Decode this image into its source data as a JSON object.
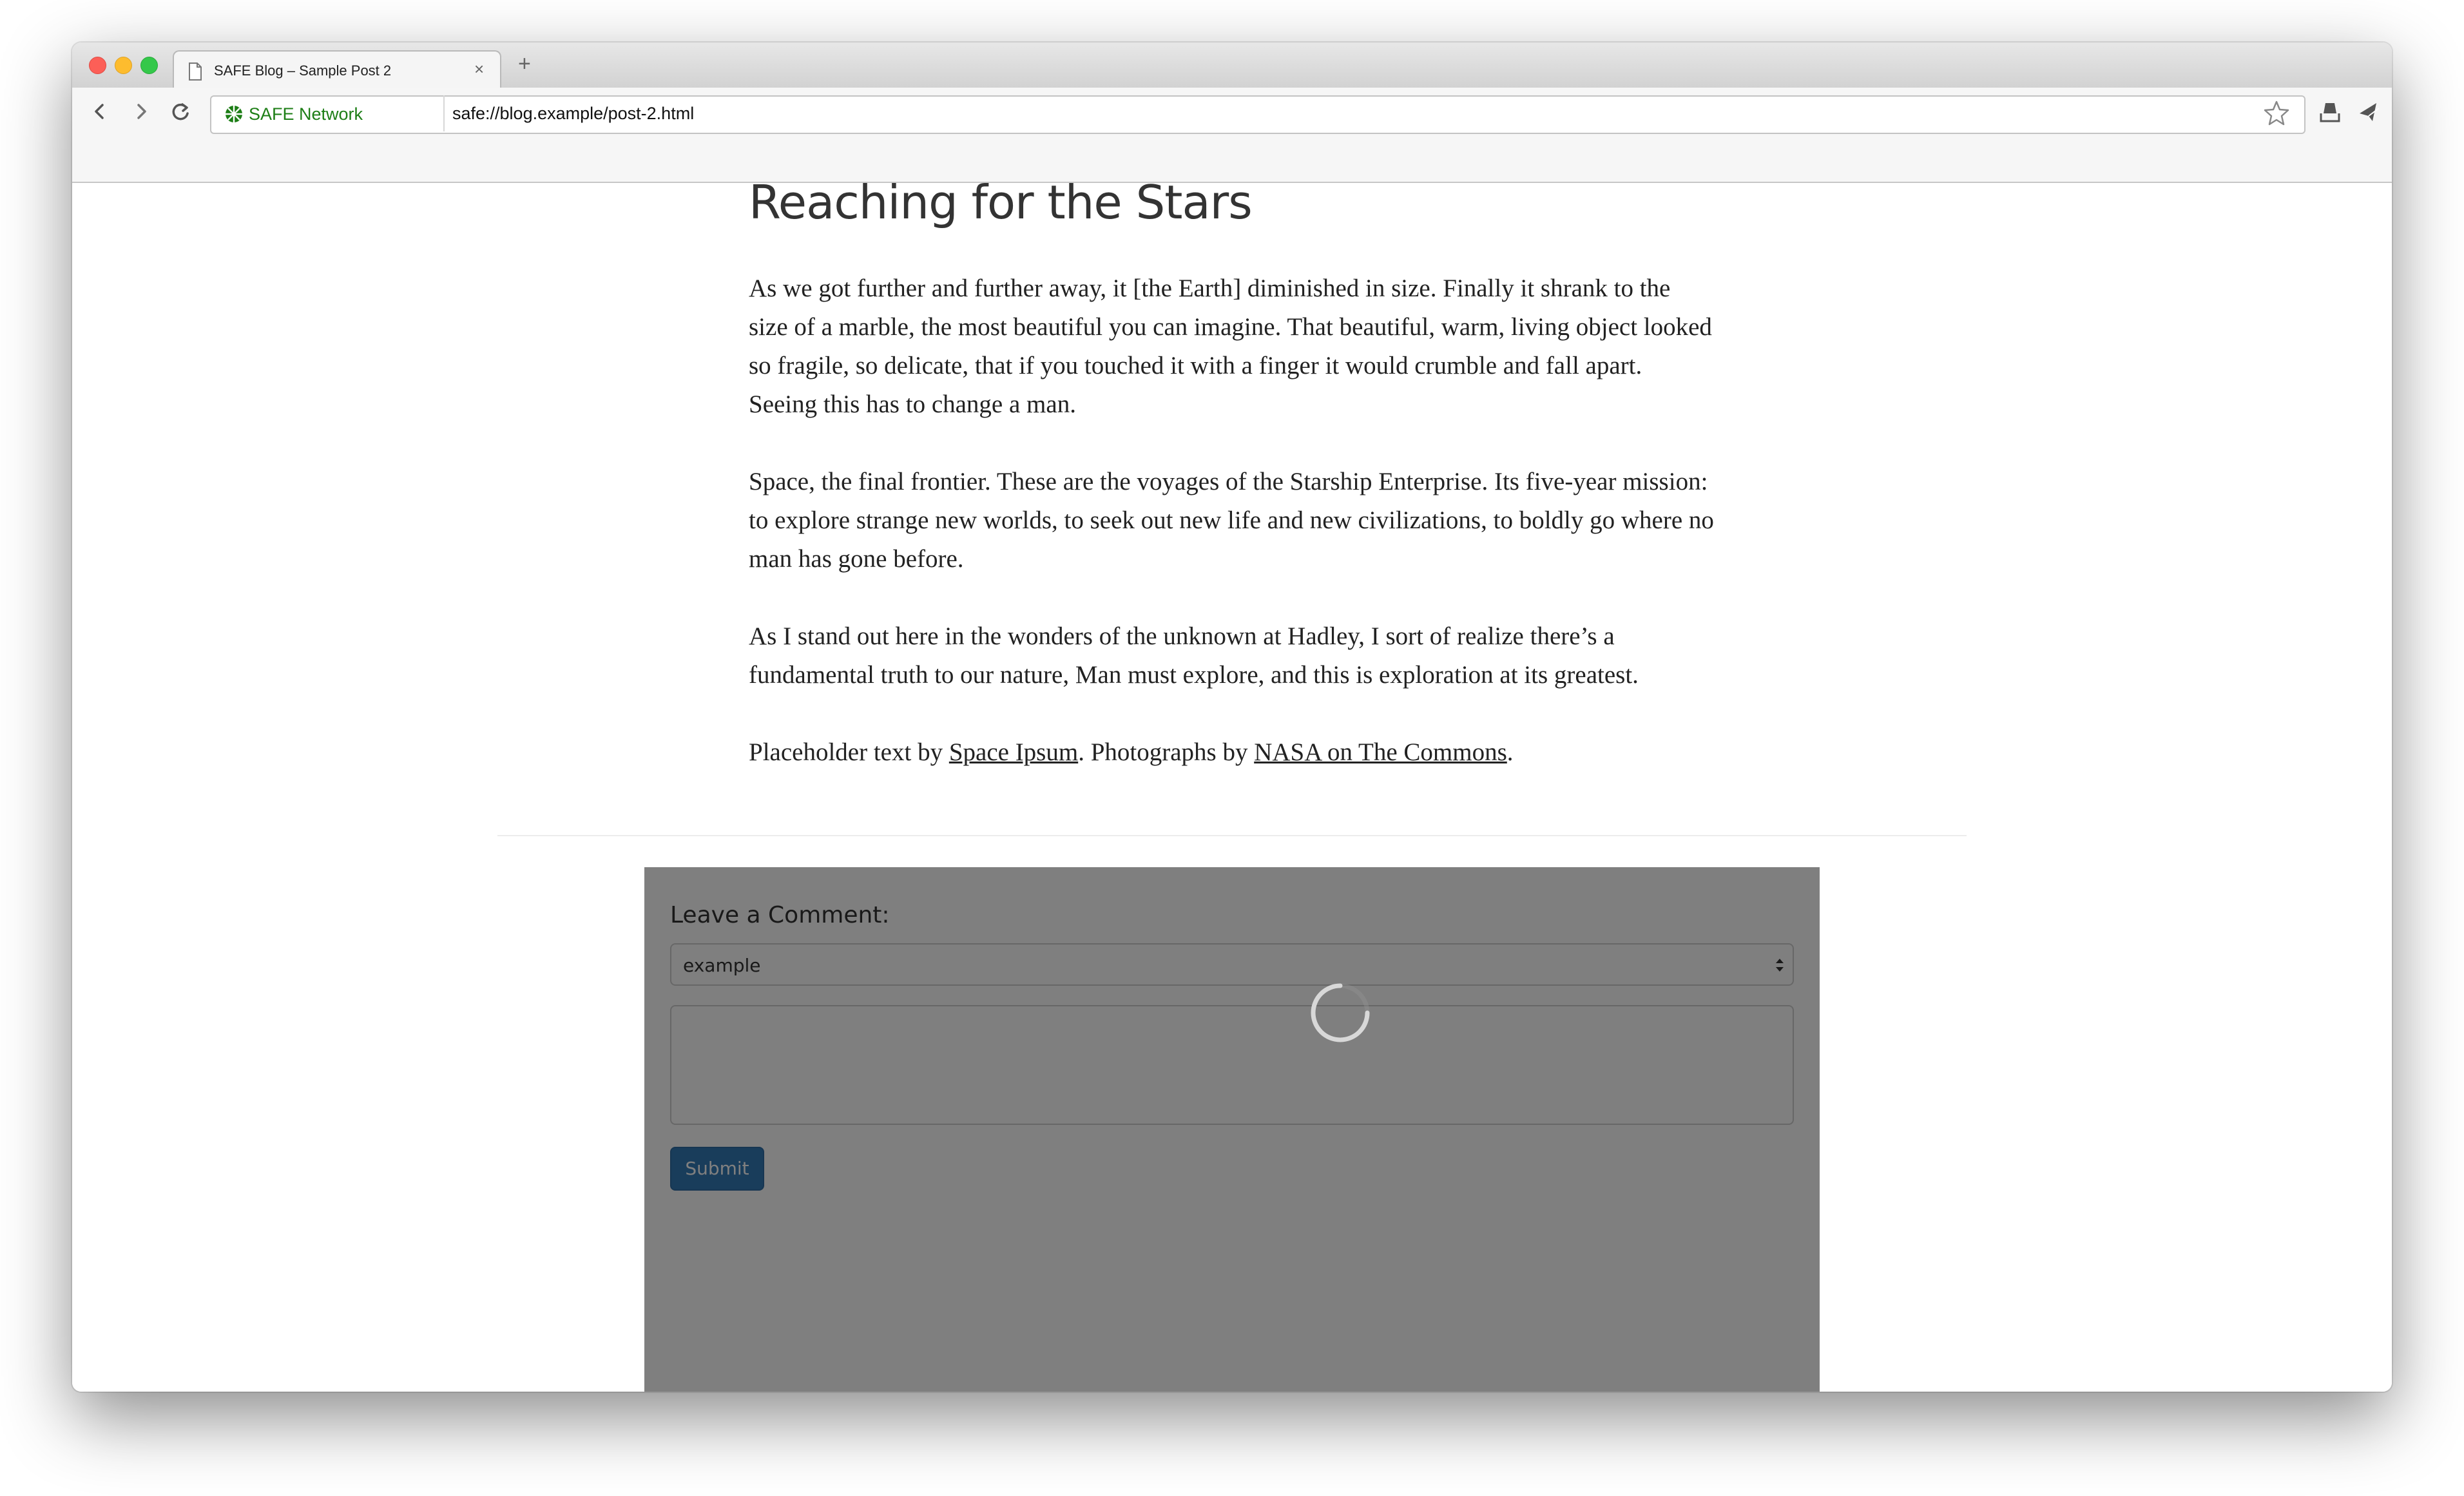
{
  "browser": {
    "tab_title": "SAFE Blog – Sample Post 2",
    "tab_close": "×",
    "new_tab": "+",
    "security_label": "SAFE Network",
    "url": "safe://blog.example/post-2.html"
  },
  "post": {
    "title": "Reaching for the Stars",
    "paragraphs": [
      "As we got further and further away, it [the Earth] diminished in size. Finally it shrank to the size of a marble, the most beautiful you can imagine. That beautiful, warm, living object looked so fragile, so delicate, that if you touched it with a finger it would crumble and fall apart. Seeing this has to change a man.",
      "Space, the final frontier. These are the voyages of the Starship Enterprise. Its five-year mission: to explore strange new worlds, to seek out new life and new civilizations, to boldly go where no man has gone before.",
      "As I stand out here in the wonders of the unknown at Hadley, I sort of realize there’s a fundamental truth to our nature, Man must explore, and this is exploration at its greatest."
    ],
    "credits": {
      "prefix": "Placeholder text by ",
      "link1": "Space Ipsum",
      "middle": ". Photographs by ",
      "link2": "NASA on The Commons",
      "suffix": "."
    }
  },
  "comment": {
    "label": "Leave a Comment:",
    "selected_id": "example",
    "body": "",
    "submit_label": "Submit",
    "loading": true
  },
  "colors": {
    "security_green": "#1d7e16",
    "submit_blue": "#337ab7",
    "overlay": "rgba(0,0,0,0.5)"
  }
}
